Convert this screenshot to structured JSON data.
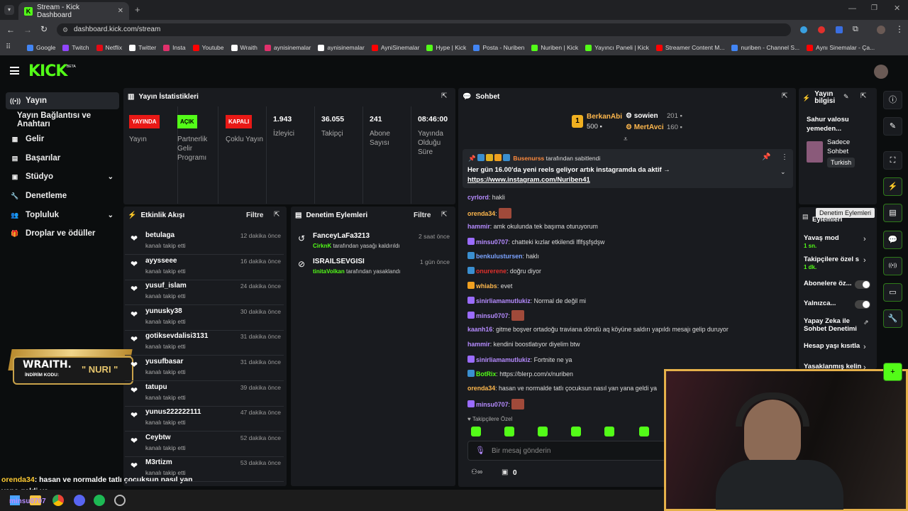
{
  "browser": {
    "tab_title": "Stream - Kick Dashboard",
    "url": "dashboard.kick.com/stream",
    "bookmarks": [
      {
        "label": "Google",
        "color": "#4285f4"
      },
      {
        "label": "Twitch",
        "color": "#9146ff"
      },
      {
        "label": "Netflix",
        "color": "#e50914"
      },
      {
        "label": "Twitter",
        "color": "#ffffff"
      },
      {
        "label": "Insta",
        "color": "#e1306c"
      },
      {
        "label": "Youtube",
        "color": "#ff0000"
      },
      {
        "label": "Wraith",
        "color": "#ffffff"
      },
      {
        "label": "aynisinemalar",
        "color": "#e1306c"
      },
      {
        "label": "aynisinemalar",
        "color": "#ffffff"
      },
      {
        "label": "AyniSinemalar",
        "color": "#ff0000"
      },
      {
        "label": "Hype | Kick",
        "color": "#53fc18"
      },
      {
        "label": "Posta - Nuriben",
        "color": "#4285f4"
      },
      {
        "label": "Nuriben | Kick",
        "color": "#53fc18"
      },
      {
        "label": "Yayıncı Paneli | Kick",
        "color": "#53fc18"
      },
      {
        "label": "Streamer Content M...",
        "color": "#ff0000"
      },
      {
        "label": "nuriben - Channel S...",
        "color": "#4285f4"
      },
      {
        "label": "Aynı Sinemalar - Ça...",
        "color": "#ff0000"
      }
    ]
  },
  "kick": {
    "logo": "KICK",
    "beta": "BETA"
  },
  "sidebar": [
    {
      "label": "Yayın",
      "icon": "broadcast-icon"
    },
    {
      "label": "Yayın Bağlantısı ve Anahtarı",
      "icon": ""
    },
    {
      "label": "Gelir",
      "icon": "income-icon"
    },
    {
      "label": "Başarılar",
      "icon": "achievements-icon"
    },
    {
      "label": "Stüdyo",
      "icon": "studio-icon"
    },
    {
      "label": "Denetleme",
      "icon": "wrench-icon"
    },
    {
      "label": "Topluluk",
      "icon": "community-icon"
    },
    {
      "label": "Droplar ve ödüller",
      "icon": "gift-icon"
    }
  ],
  "stats": {
    "title": "Yayın İstatistikleri",
    "badges": [
      {
        "badge": "YAYINDA",
        "label": "Yayın",
        "color": "#e91916"
      },
      {
        "badge": "AÇIK",
        "label": "Partnerlik Gelir Programı",
        "color": "#53fc18"
      },
      {
        "badge": "KAPALI",
        "label": "Çoklu Yayın",
        "color": "#e91916"
      }
    ],
    "numbers": [
      {
        "value": "1.943",
        "label": "İzleyici"
      },
      {
        "value": "36.055",
        "label": "Takipçi"
      },
      {
        "value": "241",
        "label": "Abone Sayısı"
      },
      {
        "value": "08:46:00",
        "label": "Yayında Olduğu Süre"
      }
    ]
  },
  "activity": {
    "title": "Etkinlik Akışı",
    "filter": "Filtre",
    "items": [
      {
        "name": "betulaga",
        "sub": "kanalı takip etti",
        "time": "12 dakika önce"
      },
      {
        "name": "ayysseee",
        "sub": "kanalı takip etti",
        "time": "16 dakika önce"
      },
      {
        "name": "yusuf_islam",
        "sub": "kanalı takip etti",
        "time": "24 dakika önce"
      },
      {
        "name": "yunusky38",
        "sub": "kanalı takip etti",
        "time": "30 dakika önce"
      },
      {
        "name": "gotiksevdalisi3131",
        "sub": "kanalı takip etti",
        "time": "31 dakika önce"
      },
      {
        "name": "yusufbasar",
        "sub": "kanalı takip etti",
        "time": "31 dakika önce"
      },
      {
        "name": "tatupu",
        "sub": "kanalı takip etti",
        "time": "39 dakika önce"
      },
      {
        "name": "yunus222222111",
        "sub": "kanalı takip etti",
        "time": "47 dakika önce"
      },
      {
        "name": "Ceybtw",
        "sub": "kanalı takip etti",
        "time": "52 dakika önce"
      },
      {
        "name": "M3rtizm",
        "sub": "kanalı takip etti",
        "time": "53 dakika önce"
      }
    ]
  },
  "moderation": {
    "title": "Denetim Eylemleri",
    "filter": "Filtre",
    "items": [
      {
        "name": "FanceyLaFa3213",
        "by": "CirknK",
        "action": "tarafından yasağı kaldırıldı",
        "time": "2 saat önce"
      },
      {
        "name": "ISRAILSEVGISI",
        "by": "tinitaVolkan",
        "action": "tarafından yasaklandı",
        "time": "1 gün önce"
      }
    ]
  },
  "chat": {
    "title": "Sohbet",
    "leaders": [
      {
        "rank": "1",
        "name": "BerkanAbi",
        "amount": "500"
      },
      {
        "name": "sowien",
        "amount": "201"
      },
      {
        "name": "MertAvci",
        "amount": "160"
      }
    ],
    "pinned": {
      "user": "Busenurss",
      "by": "tarafından sabitlendi",
      "text": "Her gün 16.00'da yeni reels geliyor artık instagramda da aktif →",
      "link": "https://www.instagram.com/Nuriben41"
    },
    "messages": [
      {
        "user": "cyrlord",
        "color": "#b58bff",
        "text": "hakli"
      },
      {
        "user": "orenda34",
        "color": "#ffb84d",
        "text": ""
      },
      {
        "user": "hammir",
        "color": "#b58bff",
        "text": "amk okulunda tek başıma oturuyorum"
      },
      {
        "user": "minsu0707",
        "color": "#b58bff",
        "text": "chatteki kızlar etkilendi lflfşşfşdşw"
      },
      {
        "user": "benkulustursen",
        "color": "#7aa2ff",
        "text": "haklı"
      },
      {
        "user": "onurerene",
        "color": "#e0302c",
        "text": "doğru diyor"
      },
      {
        "user": "whiabs",
        "color": "#ffb84d",
        "text": "evet"
      },
      {
        "user": "sinirliamamutlukiz",
        "color": "#b58bff",
        "text": "Normal de değil mi"
      },
      {
        "user": "minsu0707",
        "color": "#b58bff",
        "text": ""
      },
      {
        "user": "kaanh16",
        "color": "#b58bff",
        "text": "gitme boşver ortadoğu traviana döndü aq köyüne saldırı yapıldı mesajı gelip duruyor"
      },
      {
        "user": "hammir",
        "color": "#b58bff",
        "text": "kendini boostlatıyor diyelim btw"
      },
      {
        "user": "sinirliamamutlukiz",
        "color": "#b58bff",
        "text": "Fortnite ne ya"
      },
      {
        "user": "BotRix",
        "color": "#53fc18",
        "text": "https://blerp.com/x/nuriben"
      },
      {
        "user": "orenda34",
        "color": "#ffb84d",
        "text": "hasan ve normalde tatlı çocuksun nasıl yan yana geldi ya"
      },
      {
        "user": "minsu0707",
        "color": "#b58bff",
        "text": ""
      }
    ],
    "followers_only": "Takipçilere Özel",
    "placeholder": "Bir mesaj gönderin",
    "count": "0"
  },
  "info": {
    "title": "Yayın bilgisi",
    "stream_title": "Sahur valosu yemeden...",
    "category": "Sadece Sohbet",
    "language": "Turkish"
  },
  "modtools": {
    "tooltip": "Denetim Eylemleri",
    "title_frag": "Eylemleri",
    "rows": [
      {
        "label": "Yavaş mod",
        "sub": "1 sn."
      },
      {
        "label": "Takipçilere özel s",
        "sub": "1 dk."
      },
      {
        "label": "Abonelere öz..."
      },
      {
        "label": "Yalnızca..."
      },
      {
        "label": "Yapay Zeka ile Sohbet Denetimi"
      },
      {
        "label": "Hesap yaşı kısıtla"
      },
      {
        "label": "Yasaklanmış kelin"
      }
    ]
  },
  "overlay": {
    "brand": "WRAITH.",
    "code_label": "İNDİRİM KODU:",
    "code": "\" NURI \"",
    "chat_user": "orenda34",
    "chat_text": ": hasan ve normalde tatlı çocuksun nasıl yan yana geldi ya",
    "chat_user2": "minsu0707"
  }
}
